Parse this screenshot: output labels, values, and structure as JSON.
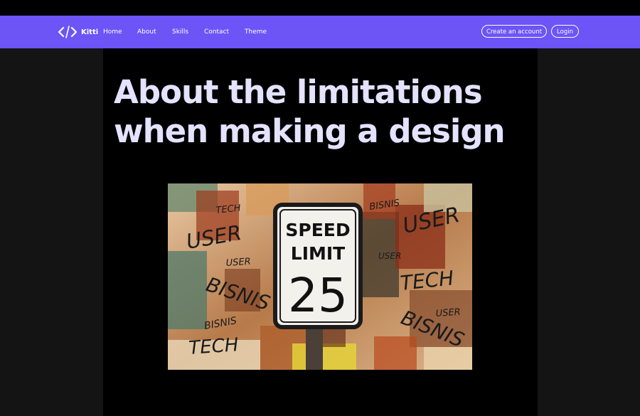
{
  "navbar": {
    "brand": "Kitti",
    "links": [
      "Home",
      "About",
      "Skills",
      "Contact",
      "Theme"
    ],
    "create_account": "Create an account",
    "login": "Login",
    "accent": "#6d54f7"
  },
  "article": {
    "title": "About the limitations when making a design",
    "title_color": "#e4e2ff"
  },
  "hero_image": {
    "sign": {
      "line1": "SPEED",
      "line2": "LIMIT",
      "number": "25"
    },
    "graffiti": [
      "TECH",
      "USER",
      "USER",
      "BISNIS",
      "BISNIS",
      "TECH",
      "BISNIS",
      "USER",
      "USER",
      "TECH",
      "USER",
      "BISNIS"
    ]
  }
}
